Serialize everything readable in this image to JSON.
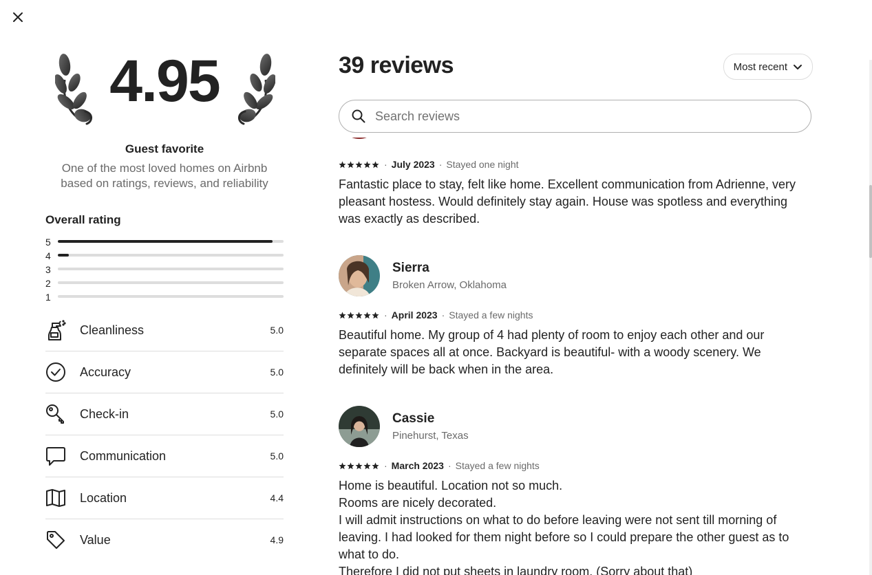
{
  "dialog": {
    "close_icon": "close-icon"
  },
  "summary": {
    "rating": "4.95",
    "badge_title": "Guest favorite",
    "badge_desc_line1": "One of the most loved homes on Airbnb",
    "badge_desc_line2": "based on ratings, reviews, and reliability"
  },
  "overall": {
    "title": "Overall rating",
    "distribution": [
      {
        "star": "5",
        "fraction": 0.95
      },
      {
        "star": "4",
        "fraction": 0.05
      },
      {
        "star": "3",
        "fraction": 0
      },
      {
        "star": "2",
        "fraction": 0
      },
      {
        "star": "1",
        "fraction": 0
      }
    ]
  },
  "categories": [
    {
      "label": "Cleanliness",
      "score": "5.0",
      "icon": "spray-bottle-icon"
    },
    {
      "label": "Accuracy",
      "score": "5.0",
      "icon": "check-circle-icon"
    },
    {
      "label": "Check-in",
      "score": "5.0",
      "icon": "key-icon"
    },
    {
      "label": "Communication",
      "score": "5.0",
      "icon": "chat-bubble-icon"
    },
    {
      "label": "Location",
      "score": "4.4",
      "icon": "map-icon"
    },
    {
      "label": "Value",
      "score": "4.9",
      "icon": "tag-icon"
    }
  ],
  "reviews_header": {
    "count_label": "39 reviews",
    "sort_label": "Most recent",
    "search_placeholder": "Search reviews"
  },
  "reviews": [
    {
      "date": "July 2023",
      "stay": "Stayed one night",
      "stars": 5,
      "text": [
        "Fantastic place to stay, felt like home. Excellent communication from Adrienne, very pleasant hostess. Would definitely stay again. House was spotless and everything was exactly as described."
      ]
    },
    {
      "name": "Sierra",
      "location": "Broken Arrow, Oklahoma",
      "date": "April 2023",
      "stay": "Stayed a few nights",
      "stars": 5,
      "text": [
        "Beautiful home. My group of 4 had plenty of room to enjoy each other and our separate spaces all at once. Backyard is beautiful- with a woody scenery. We definitely will be back when in the area."
      ]
    },
    {
      "name": "Cassie",
      "location": "Pinehurst, Texas",
      "date": "March 2023",
      "stay": "Stayed a few nights",
      "stars": 5,
      "text": [
        "Home is beautiful. Location not so much.",
        "Rooms are nicely decorated.",
        "I will admit instructions on what to do before leaving were not sent till morning of leaving. I had looked for them night before so I could prepare the other guest as to what to do.",
        "Therefore I did not put sheets in laundry room. (Sorry about that)"
      ]
    }
  ],
  "meta_separator": "·",
  "colors": {
    "text": "#222222",
    "muted": "#6a6a6a",
    "border": "#dddddd"
  }
}
